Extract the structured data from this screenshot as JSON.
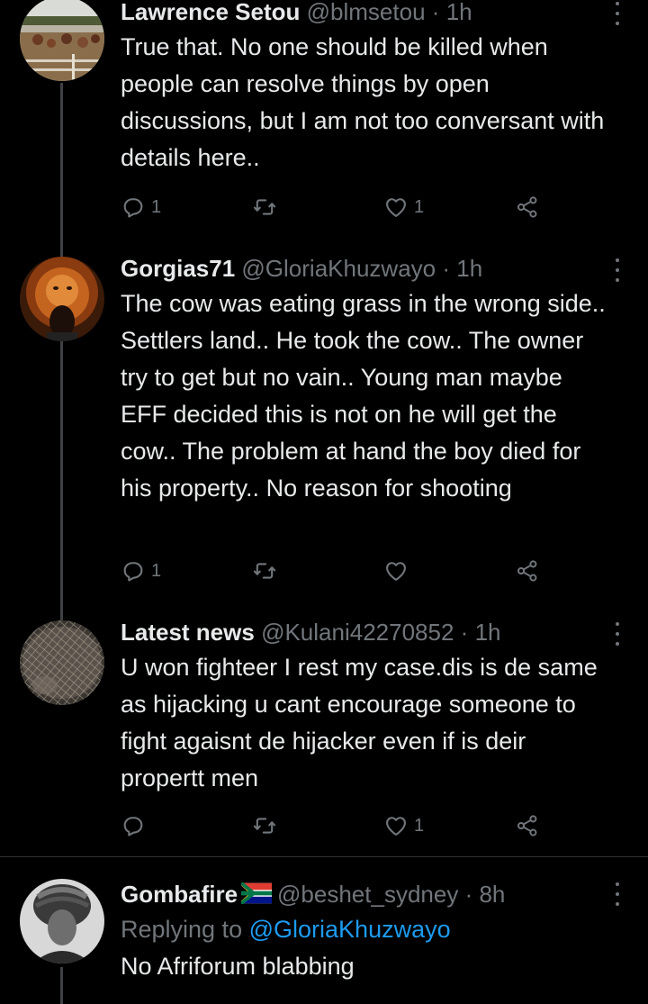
{
  "tweets": [
    {
      "name": "Lawrence Setou",
      "handle": "@blmsetou",
      "sep": "·",
      "time": "1h",
      "text": "True that. No one should be killed when people can resolve things by open discussions, but I am not too conversant with details here..",
      "replies": "1",
      "retweets": "",
      "likes": "1"
    },
    {
      "name": "Gorgias71",
      "handle": "@GloriaKhuzwayo",
      "sep": "·",
      "time": "1h",
      "text": "The cow was eating grass in the wrong side.. Settlers land.. He took the cow.. The owner try to get but no vain.. Young man maybe EFF decided this is not on he will get the cow.. The problem at hand the boy died for his property.. No reason for shooting",
      "replies": "1",
      "retweets": "",
      "likes": ""
    },
    {
      "name": "Latest news",
      "handle": "@Kulani42270852",
      "sep": "·",
      "time": "1h",
      "text": "U won fighteer I rest my case.dis is de same as hijacking u cant encourage someone to fight agaisnt de hijacker even if is deir propertt men",
      "replies": "",
      "retweets": "",
      "likes": "1"
    },
    {
      "name": "Gombafire",
      "handle": "@beshet_sydney",
      "sep": "·",
      "time": "8h",
      "replying_prefix": "Replying to",
      "replying_handle": "@GloriaKhuzwayo",
      "text": "No Afriforum blabbing"
    }
  ],
  "icons": [
    "reply-icon",
    "retweet-icon",
    "like-icon",
    "share-icon",
    "more-icon",
    "south-africa-flag-icon"
  ],
  "colors": {
    "background": "#000000",
    "text": "#e7e9ea",
    "muted": "#71767b",
    "link": "#1d9bf0",
    "thread": "#3e4144"
  }
}
